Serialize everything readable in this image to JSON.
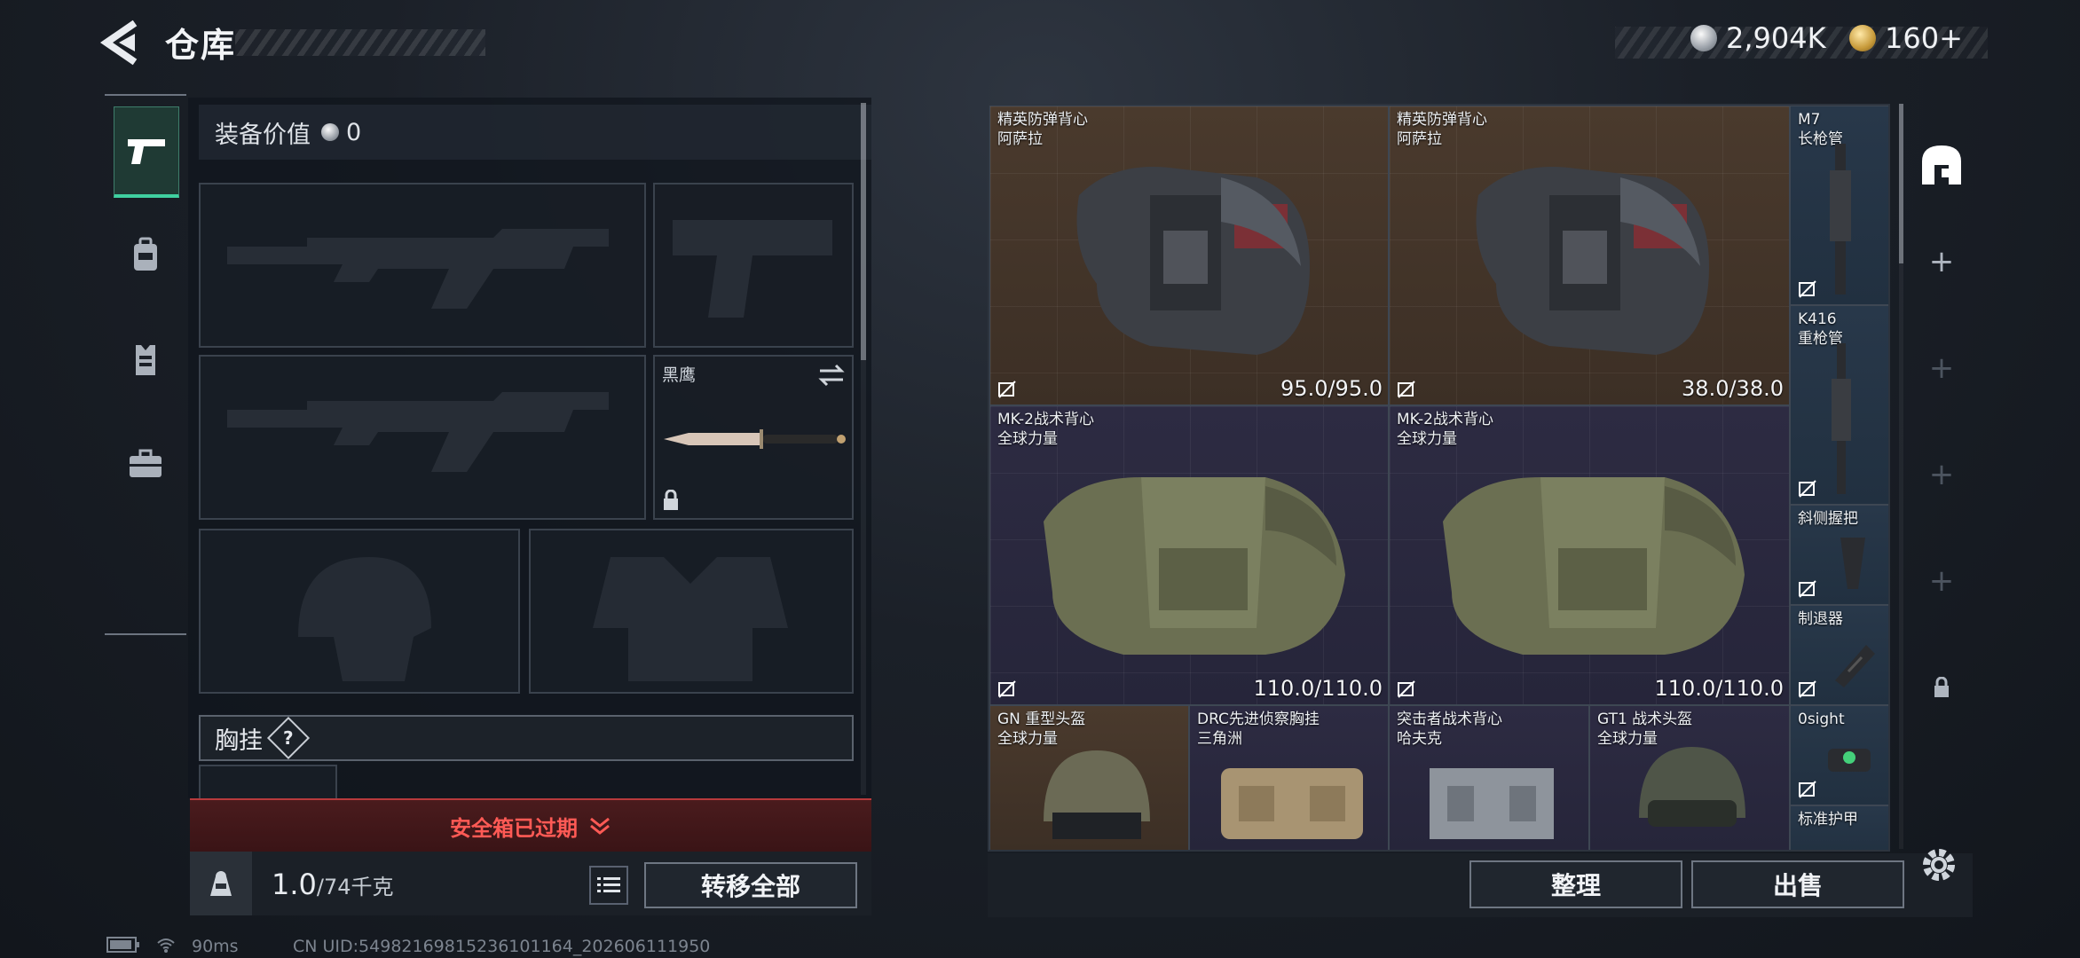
{
  "header": {
    "title": "仓库",
    "back_icon": "back-arrow-icon",
    "currencies": [
      {
        "icon": "silver-coin-icon",
        "value": "2,904K"
      },
      {
        "icon": "gold-coin-icon",
        "value": "160+"
      }
    ]
  },
  "tabs": [
    {
      "icon": "pistol-icon",
      "active": true
    },
    {
      "icon": "backpack-icon",
      "active": false
    },
    {
      "icon": "vest-icon",
      "active": false
    },
    {
      "icon": "briefcase-icon",
      "active": false
    }
  ],
  "loadout": {
    "value_label": "装备价值",
    "value": "0",
    "melee_name": "黑鹰",
    "chest_label": "胸挂",
    "chest_help": "?"
  },
  "safe_box": {
    "label": "安全箱已过期"
  },
  "footer_left": {
    "weight": "1.0",
    "capacity": "/74千克",
    "transfer_all": "转移全部"
  },
  "stash": {
    "items": [
      {
        "name": "精英防弹背心",
        "brand": "阿萨拉",
        "durability": "95.0/95.0",
        "rarity": "brown"
      },
      {
        "name": "精英防弹背心",
        "brand": "阿萨拉",
        "durability": "38.0/38.0",
        "rarity": "brown"
      },
      {
        "name": "M7",
        "brand": "长枪管",
        "durability": "",
        "rarity": "blue"
      },
      {
        "name": "K416",
        "brand": "重枪管",
        "durability": "",
        "rarity": "blue"
      },
      {
        "name": "MK-2战术背心",
        "brand": "全球力量",
        "durability": "110.0/110.0",
        "rarity": "purple"
      },
      {
        "name": "MK-2战术背心",
        "brand": "全球力量",
        "durability": "110.0/110.0",
        "rarity": "purple"
      },
      {
        "name": "斜侧握把",
        "brand": "",
        "durability": "",
        "rarity": "blue"
      },
      {
        "name": "制退器",
        "brand": "",
        "durability": "",
        "rarity": "blue"
      },
      {
        "name": "GN 重型头盔",
        "brand": "全球力量",
        "durability": "",
        "rarity": "brown"
      },
      {
        "name": "DRC先进侦察胸挂",
        "brand": "三角洲",
        "durability": "",
        "rarity": "purple"
      },
      {
        "name": "突击者战术背心",
        "brand": "哈夫克",
        "durability": "",
        "rarity": "purple"
      },
      {
        "name": "GT1 战术头盔",
        "brand": "全球力量",
        "durability": "",
        "rarity": "purple"
      },
      {
        "name": "0sight",
        "brand": "",
        "durability": "",
        "rarity": "blue"
      },
      {
        "name": "标准护甲",
        "brand": "",
        "durability": "",
        "rarity": "blue"
      }
    ],
    "side_icons": [
      "stash-home-icon",
      "plus-icon",
      "plus-icon",
      "plus-icon",
      "plus-icon",
      "lock-icon"
    ]
  },
  "footer_right": {
    "sort": "整理",
    "sell": "出售",
    "settings_icon": "gear-icon"
  },
  "status_bar": {
    "ping": "90ms",
    "uid": "CN UID:5498216981523610116​4_202606111950"
  }
}
